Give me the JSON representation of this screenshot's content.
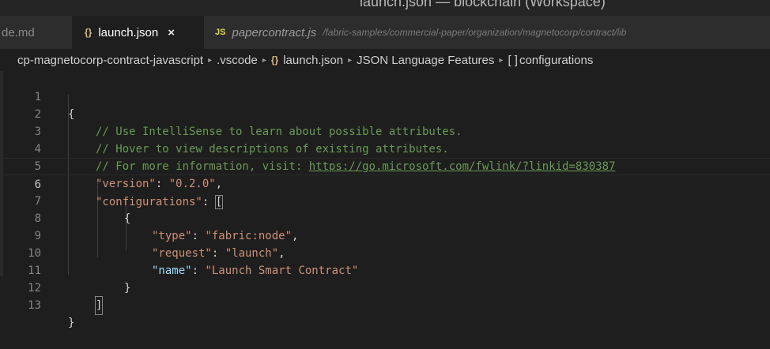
{
  "window": {
    "title": "launch.json — blockchain (Workspace)"
  },
  "tabs": [
    {
      "label": "de.md"
    },
    {
      "label": "launch.json",
      "icon": "{}",
      "close": "×"
    },
    {
      "label": "papercontract.js",
      "icon": "JS",
      "path": "/fabric-samples/commercial-paper/organization/magnetocorp/contract/lib"
    }
  ],
  "breadcrumb": {
    "items": [
      "cp-magnetocorp-contract-javascript",
      ".vscode",
      "launch.json",
      "JSON Language Features",
      "configurations"
    ],
    "json_icon": "{}",
    "array_icon": "[ ]",
    "separator": "▸"
  },
  "editor": {
    "line_numbers": [
      "1",
      "2",
      "3",
      "4",
      "5",
      "6",
      "7",
      "8",
      "9",
      "10",
      "11",
      "12",
      "13"
    ],
    "active_line": 6,
    "lines": {
      "l1": "{",
      "l2": "// Use IntelliSense to learn about possible attributes.",
      "l3": "// Hover to view descriptions of existing attributes.",
      "l4_prefix": "// For more information, visit: ",
      "l4_link": "https://go.microsoft.com/fwlink/?linkid=830387",
      "l5_key": "\"version\"",
      "l5_val": "\"0.2.0\"",
      "l6_key": "\"configurations\"",
      "l7": "{",
      "l8_key": "\"type\"",
      "l8_val": "\"fabric:node\"",
      "l9_key": "\"request\"",
      "l9_val": "\"launch\"",
      "l10_key": "\"name\"",
      "l10_val": "\"Launch Smart Contract\"",
      "l11": "}",
      "l13": "}"
    }
  }
}
